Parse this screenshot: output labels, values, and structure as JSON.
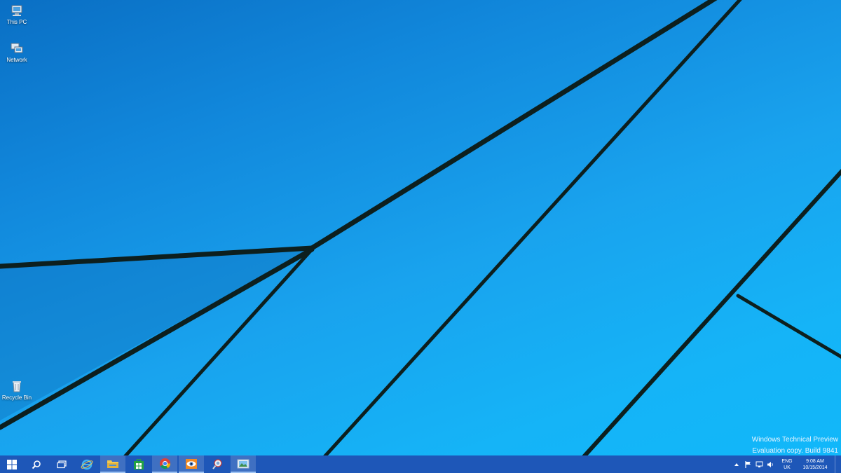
{
  "desktop": {
    "icons": [
      {
        "label": "This PC",
        "icon": "this-pc-icon"
      },
      {
        "label": "Network",
        "icon": "network-icon"
      },
      {
        "label": "Recycle Bin",
        "icon": "recycle-bin-icon"
      }
    ],
    "watermark": {
      "line1": "Windows Technical Preview",
      "line2": "Evaluation copy. Build 9841"
    }
  },
  "taskbar": {
    "buttons": [
      {
        "icon": "start-icon"
      },
      {
        "icon": "search-icon"
      },
      {
        "icon": "task-view-icon"
      },
      {
        "icon": "internet-explorer-icon"
      },
      {
        "icon": "file-explorer-icon"
      },
      {
        "icon": "store-icon"
      },
      {
        "icon": "chrome-icon"
      },
      {
        "icon": "eye-app-icon"
      },
      {
        "icon": "magnifier-app-icon"
      },
      {
        "icon": "image-viewer-icon"
      }
    ],
    "tray": {
      "icons": [
        "show-hidden-icons-icon",
        "action-center-flag-icon",
        "network-tray-icon",
        "volume-icon"
      ],
      "language": {
        "line1": "ENG",
        "line2": "UK"
      },
      "time": "9:08 AM",
      "date": "10/15/2014"
    }
  },
  "colors": {
    "taskbar": "#1e57b8",
    "wallpaper_dark": "#0a6fc4",
    "wallpaper_light": "#10b8fa",
    "line": "#0d1f1e"
  }
}
